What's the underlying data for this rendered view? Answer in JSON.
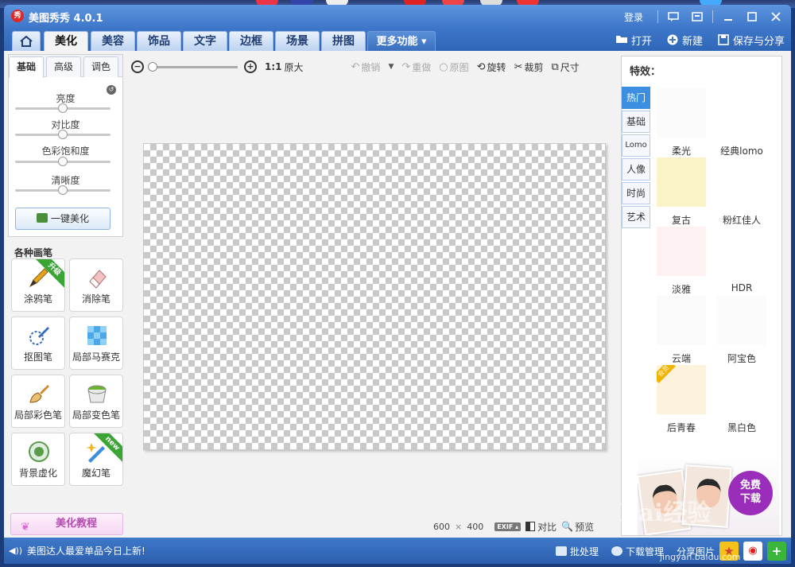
{
  "app": {
    "title": "美图秀秀 4.0.1",
    "logo_text": "秀",
    "login": "登录"
  },
  "tabs": [
    {
      "label": "美化",
      "active": true
    },
    {
      "label": "美容"
    },
    {
      "label": "饰品"
    },
    {
      "label": "文字"
    },
    {
      "label": "边框"
    },
    {
      "label": "场景"
    },
    {
      "label": "拼图"
    },
    {
      "label": "更多功能 ▾"
    }
  ],
  "actions": {
    "open": "打开",
    "new": "新建",
    "save": "保存与分享"
  },
  "adjust": {
    "subtabs": [
      "基础",
      "高级",
      "调色"
    ],
    "sliders": [
      {
        "label": "亮度",
        "value": 0.5
      },
      {
        "label": "对比度",
        "value": 0.5
      },
      {
        "label": "色彩饱和度",
        "value": 0.5
      },
      {
        "label": "清晰度",
        "value": 0.5
      }
    ],
    "one_click": "一键美化"
  },
  "brushes": {
    "title": "各种画笔",
    "items": [
      {
        "label": "涂鸦笔",
        "badge": "升级",
        "icon": "pen-icon",
        "color": "#e3a51e"
      },
      {
        "label": "消除笔",
        "icon": "eraser-icon",
        "color": "#f0b7b7"
      },
      {
        "label": "抠图笔",
        "icon": "cutout-pen-icon",
        "color": "#3a6fc0"
      },
      {
        "label": "局部马赛克",
        "icon": "mosaic-icon",
        "color": "#4aa7e8"
      },
      {
        "label": "局部彩色笔",
        "icon": "paint-brush-icon",
        "color": "#d08a2c"
      },
      {
        "label": "局部变色笔",
        "icon": "paint-bucket-icon",
        "color": "#6bb32e"
      },
      {
        "label": "背景虚化",
        "icon": "blur-icon",
        "color": "#5a9c4a"
      },
      {
        "label": "魔幻笔",
        "badge": "new",
        "icon": "magic-wand-icon",
        "color": "#3b8de0"
      }
    ],
    "tutorial": "美化教程"
  },
  "toolbar": {
    "ratio": "1:1",
    "original_size": "原大",
    "undo": "撤销",
    "redo": "重做",
    "original": "原图",
    "rotate": "旋转",
    "crop": "裁剪",
    "resize": "尺寸",
    "zoom_level": 0.0
  },
  "status": {
    "width": "600",
    "times": "×",
    "height": "400",
    "exif": "EXIF ▴",
    "compare": "对比",
    "preview": "预览"
  },
  "effects": {
    "title": "特效：",
    "categories": [
      "热门",
      "基础",
      "Lomo",
      "人像",
      "时尚",
      "艺术"
    ],
    "items": [
      {
        "label": "柔光",
        "color": "#fbfbfb"
      },
      {
        "label": "经典lomo",
        "color": "#ffffff"
      },
      {
        "label": "复古",
        "color": "#fbf3c8"
      },
      {
        "label": "粉红佳人",
        "color": "#ffffff"
      },
      {
        "label": "淡雅",
        "color": "#fdf1f1"
      },
      {
        "label": "HDR",
        "color": "#ffffff"
      },
      {
        "label": "云端",
        "color": "#fafafa"
      },
      {
        "label": "阿宝色",
        "color": "#fbfbfb"
      },
      {
        "label": "后青春",
        "color": "#fdf3dd",
        "tag": "会员"
      },
      {
        "label": "黑白色",
        "color": "#ffffff"
      }
    ],
    "ad": {
      "line1": "免费",
      "line2": "下载"
    }
  },
  "bottom": {
    "news": "美图达人最爱单品今日上新!",
    "batch": "批处理",
    "download_manager": "下载管理",
    "share": "分享图片"
  },
  "watermark": {
    "brand": "Bai经验",
    "url": "jingyan.baidu.com"
  }
}
